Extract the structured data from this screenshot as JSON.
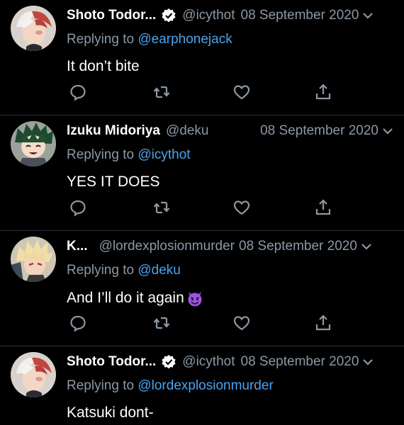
{
  "tweets": [
    {
      "name": "Shoto Todor...",
      "verified": true,
      "handle": "@icythot",
      "date": "08 September 2020",
      "replying_prefix": "Replying to",
      "replying_to": "@earphonejack",
      "text": "It don’t bite",
      "avatar": "shoto-avatar"
    },
    {
      "name": "Izuku Midoriya",
      "verified": false,
      "handle": "@deku",
      "date": "08 September 2020",
      "replying_prefix": "Replying to",
      "replying_to": "@icythot",
      "text": "YES IT DOES",
      "avatar": "izuku-avatar"
    },
    {
      "name": "K...",
      "verified": false,
      "handle": "@lordexplosionmurder",
      "date": "08 September 2020",
      "replying_prefix": "Replying to",
      "replying_to": "@deku",
      "text": "And I’ll do it again",
      "emoji": "smiling-imp-emoji",
      "avatar": "katsuki-avatar"
    },
    {
      "name": "Shoto Todor...",
      "verified": true,
      "handle": "@icythot",
      "date": "08 September 2020",
      "replying_prefix": "Replying to",
      "replying_to": "@lordexplosionmurder",
      "text": "Katsuki dont-",
      "avatar": "shoto-avatar"
    }
  ],
  "action_icons": [
    "reply-icon",
    "retweet-icon",
    "like-icon",
    "share-icon"
  ],
  "colors": {
    "background": "#000000",
    "secondary_text": "#8b98a5",
    "mention": "#4aa3ef",
    "divider": "#2f3336"
  }
}
